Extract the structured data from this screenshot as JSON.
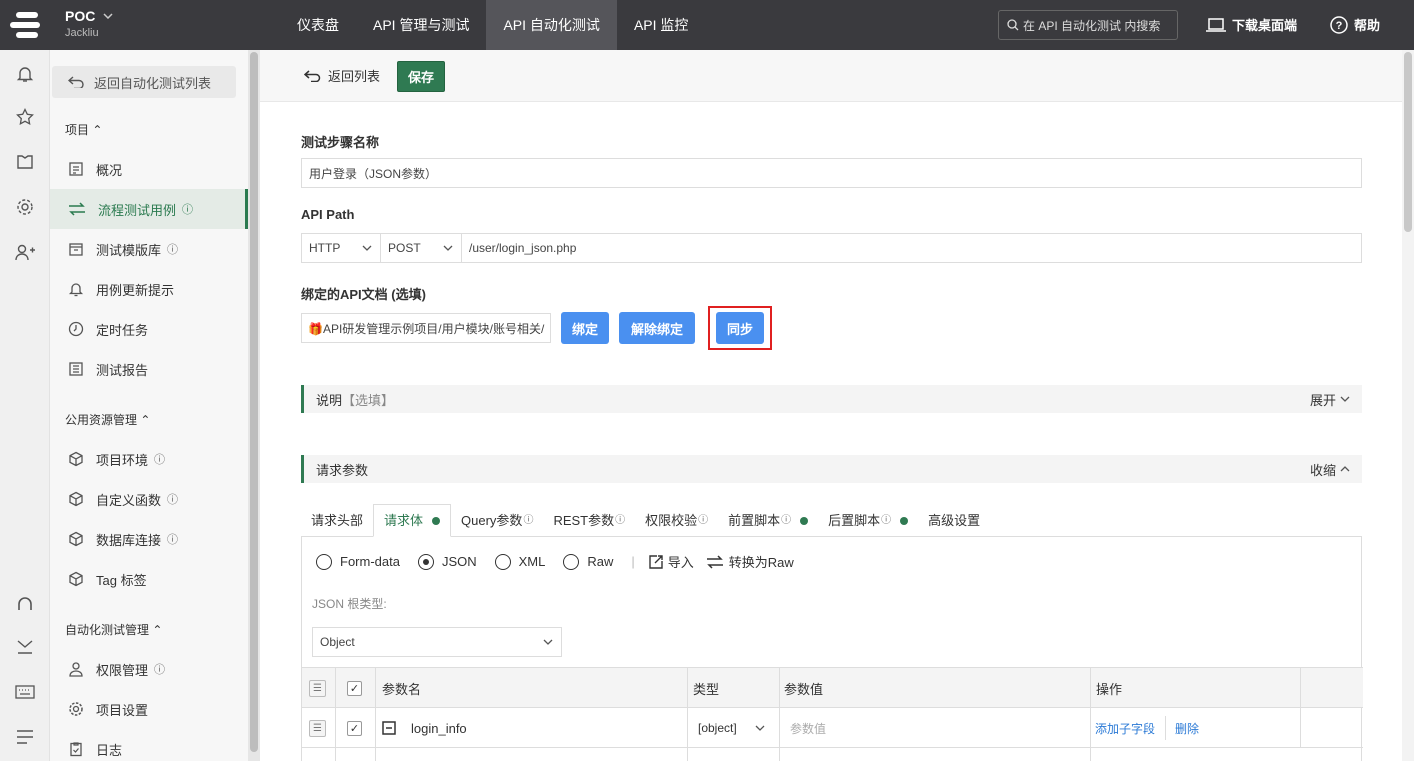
{
  "topbar": {
    "project_name": "POC",
    "user_name": "Jackliu",
    "nav": [
      "仪表盘",
      "API 管理与测试",
      "API 自动化测试",
      "API 监控"
    ],
    "active_nav": 2,
    "search_placeholder": "在 API 自动化测试 内搜索",
    "download_label": "下载桌面端",
    "help_label": "帮助"
  },
  "rail_icons": [
    "bell-icon",
    "star-icon",
    "shirt-icon",
    "gear-icon",
    "add-user-icon",
    "headset-icon",
    "download-tray-icon",
    "keyboard-icon",
    "menu-icon"
  ],
  "sidebar": {
    "back_label": "返回自动化测试列表",
    "section_project": "项目",
    "project_items": [
      {
        "label": "概况",
        "icon": "overview-icon",
        "info": false
      },
      {
        "label": "流程测试用例",
        "icon": "swap-icon",
        "info": true
      },
      {
        "label": "测试模版库",
        "icon": "box-icon",
        "info": true
      },
      {
        "label": "用例更新提示",
        "icon": "bell-icon",
        "info": false
      },
      {
        "label": "定时任务",
        "icon": "clock-icon",
        "info": false
      },
      {
        "label": "测试报告",
        "icon": "report-icon",
        "info": false
      }
    ],
    "section_public": "公用资源管理",
    "public_items": [
      {
        "label": "项目环境",
        "icon": "cube-icon",
        "info": true
      },
      {
        "label": "自定义函数",
        "icon": "cube-icon",
        "info": true
      },
      {
        "label": "数据库连接",
        "icon": "cube-icon",
        "info": true
      },
      {
        "label": "Tag 标签",
        "icon": "cube-icon",
        "info": false
      }
    ],
    "section_auto": "自动化测试管理",
    "auto_items": [
      {
        "label": "权限管理",
        "icon": "user-icon",
        "info": true
      },
      {
        "label": "项目设置",
        "icon": "gear-icon",
        "info": false
      },
      {
        "label": "日志",
        "icon": "clipboard-icon",
        "info": false
      }
    ],
    "info_glyph": "ⓘ",
    "caret": "⌃"
  },
  "toolbar": {
    "back_label": "返回列表",
    "save_label": "保存"
  },
  "form": {
    "step_name_label": "测试步骤名称",
    "step_name_value": "用户登录（JSON参数）",
    "api_path_label": "API Path",
    "protocol": "HTTP",
    "method": "POST",
    "path": "/user/login_json.php",
    "bind_doc_label": "绑定的API文档 (选填)",
    "bound_doc": "🎁API研发管理示例项目/用户模块/账号相关/",
    "bind_btn": "绑定",
    "unbind_btn": "解除绑定",
    "sync_btn": "同步"
  },
  "desc_section": {
    "title": "说明",
    "hint": "【选填】",
    "toggle": "展开"
  },
  "params_section": {
    "title": "请求参数",
    "toggle": "收缩"
  },
  "param_tabs": [
    {
      "label": "请求头部",
      "dot": false,
      "info": false
    },
    {
      "label": "请求体",
      "dot": true,
      "info": false
    },
    {
      "label": "Query参数",
      "dot": false,
      "info": true
    },
    {
      "label": "REST参数",
      "dot": false,
      "info": true
    },
    {
      "label": "权限校验",
      "dot": false,
      "info": true
    },
    {
      "label": "前置脚本",
      "dot": true,
      "info": true
    },
    {
      "label": "后置脚本",
      "dot": true,
      "info": true
    },
    {
      "label": "高级设置",
      "dot": false,
      "info": false
    }
  ],
  "body": {
    "formats": [
      "Form-data",
      "JSON",
      "XML",
      "Raw"
    ],
    "selected_format": 1,
    "import_label": "导入",
    "to_raw_label": "转换为Raw",
    "root_type_label": "JSON 根类型:",
    "root_type_value": "Object",
    "table": {
      "headers": {
        "name": "参数名",
        "type": "类型",
        "value": "参数值",
        "ops": "操作"
      },
      "rows": [
        {
          "name": "login_info",
          "type": "[object]",
          "value_placeholder": "参数值",
          "add_child": "添加子字段",
          "delete": "删除"
        }
      ]
    }
  },
  "colors": {
    "accent": "#2f7a52",
    "primary_btn": "#4a90f0",
    "highlight": "#e02020"
  }
}
